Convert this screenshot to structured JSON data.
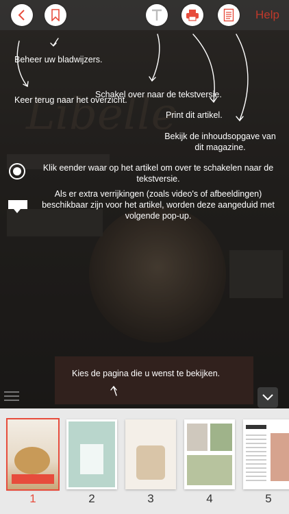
{
  "toolbar": {
    "help_label": "Help"
  },
  "tips": {
    "bookmarks": "Beheer uw bladwijzers.",
    "back": "Keer terug naar het overzicht.",
    "text_version": "Schakel over naar de tekstversie.",
    "print": "Print dit artikel.",
    "contents": "Bekijk de inhoudsopgave van dit magazine.",
    "tap_article": "Klik eender waar op het artikel om over te schakelen naar de tekstversie.",
    "extras": "Als er extra verrijkingen (zoals video's of afbeeldingen) beschikbaar zijn voor het artikel, worden deze aangeduid met volgende pop-up.",
    "choose_page": "Kies de pagina die u wenst te bekijken."
  },
  "pages": [
    {
      "number": "1",
      "selected": true
    },
    {
      "number": "2",
      "selected": false
    },
    {
      "number": "3",
      "selected": false
    },
    {
      "number": "4",
      "selected": false
    },
    {
      "number": "5",
      "selected": false
    }
  ],
  "colors": {
    "accent": "#e74c3c",
    "help": "#c0392b"
  }
}
